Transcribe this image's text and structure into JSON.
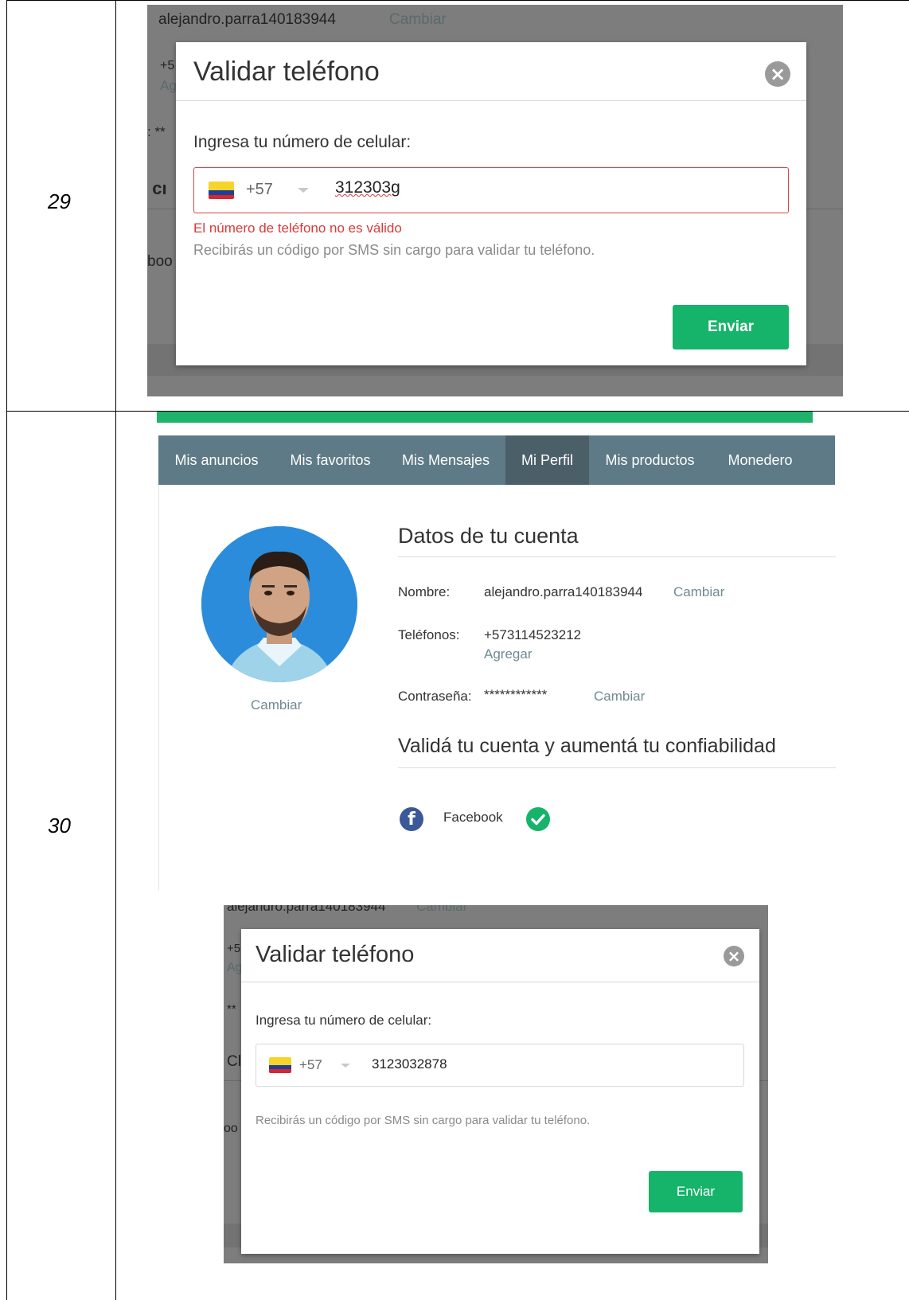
{
  "rows": [
    {
      "number": "29"
    },
    {
      "number": "30"
    }
  ],
  "shot1": {
    "backdrop": {
      "name_value": "alejandro.parra140183944",
      "name_link": "Cambiar",
      "phone_partial": "+5",
      "add_partial": "Ag",
      "password_partial": ": **",
      "section_partial": "ı cı",
      "fb_partial": "boo"
    },
    "modal": {
      "title": "Validar teléfono",
      "close_glyph": "×",
      "prompt": "Ingresa tu número de celular:",
      "country_code": "+57",
      "phone_value": "312303g",
      "error": "El número de teléfono no es válido",
      "hint": "Recibirás un código por SMS sin cargo para validar tu teléfono.",
      "send_label": "Enviar"
    }
  },
  "profile": {
    "nav": [
      "Mis anuncios",
      "Mis favoritos",
      "Mis Mensajes",
      "Mi Perfil",
      "Mis productos",
      "Monedero"
    ],
    "active_tab": "Mi Perfil",
    "avatar_change": "Cambiar",
    "account_title": "Datos de tu cuenta",
    "name_label": "Nombre:",
    "name_value": "alejandro.parra140183944",
    "name_change": "Cambiar",
    "phones_label": "Teléfonos:",
    "phone_value": "+573114523212",
    "phone_add": "Agregar",
    "password_label": "Contraseña:",
    "password_value": "************",
    "password_change": "Cambiar",
    "validate_title": "Validá tu cuenta y aumentá tu confiabilidad",
    "facebook_label": "Facebook",
    "facebook_glyph": "f"
  },
  "shot2": {
    "backdrop": {
      "name_value": "alejandro.parra140183944",
      "name_link": "Cambiar",
      "phone_partial": "+5",
      "add_partial": "Ag",
      "password_partial": "**",
      "section_partial": "Cl",
      "fb_partial": "oo"
    },
    "modal": {
      "title": "Validar teléfono",
      "close_glyph": "×",
      "prompt": "Ingresa tu número de celular:",
      "country_code": "+57",
      "phone_value": "3123032878",
      "hint": "Recibirás un código por SMS sin cargo para validar tu teléfono.",
      "send_label": "Enviar"
    }
  }
}
